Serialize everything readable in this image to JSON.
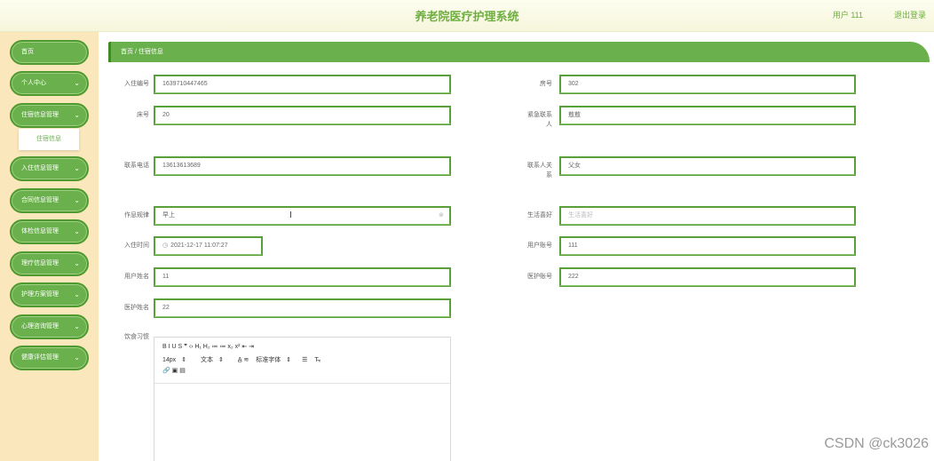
{
  "header": {
    "title": "养老院医疗护理系统",
    "user": "用户 111",
    "logout": "退出登录"
  },
  "sidebar": {
    "items": [
      {
        "label": "首页",
        "chevron": ""
      },
      {
        "label": "个人中心",
        "chevron": "⌄"
      },
      {
        "label": "住宿信息管理",
        "chevron": "⌄"
      },
      {
        "label": "入住信息管理",
        "chevron": "⌄"
      },
      {
        "label": "合同信息管理",
        "chevron": "⌄"
      },
      {
        "label": "体检信息管理",
        "chevron": "⌄"
      },
      {
        "label": "理疗信息管理",
        "chevron": "⌄"
      },
      {
        "label": "护理方案管理",
        "chevron": "⌄"
      },
      {
        "label": "心理咨询管理",
        "chevron": "⌄"
      },
      {
        "label": "健康评估管理",
        "chevron": "⌄"
      }
    ],
    "sub_item": "住宿信息"
  },
  "breadcrumb": "首页 / 住宿信息",
  "form": {
    "checkin_no": {
      "label": "入住编号",
      "value": "1639710447465"
    },
    "room_no": {
      "label": "房号",
      "value": "302"
    },
    "bed_no": {
      "label": "床号",
      "value": "20"
    },
    "emergency_contact": {
      "label_line1": "紧急联系",
      "label_line2": "人",
      "value": "敖敖"
    },
    "phone": {
      "label": "联系电话",
      "value": "13613613689"
    },
    "relation": {
      "label_line1": "联系人关",
      "label_line2": "系",
      "value": "父女"
    },
    "routine": {
      "label": "作息规律",
      "value": "早上"
    },
    "preference": {
      "label": "生活喜好",
      "placeholder": "生活喜好"
    },
    "checkin_time": {
      "label": "入住时间",
      "value": "2021-12-17 11:07:27"
    },
    "user_account": {
      "label": "用户账号",
      "value": "111"
    },
    "user_name": {
      "label": "用户姓名",
      "value": "11"
    },
    "nurse_account": {
      "label": "医护账号",
      "value": "222"
    },
    "nurse_name": {
      "label": "医护姓名",
      "value": "22"
    },
    "diet": {
      "label": "饮食习惯"
    }
  },
  "editor_toolbar": {
    "row1": "B  I  U  S   ❞  ‹›   H₁  H₂   ≔  ≔   x₂  x²   ⇤  ⇥",
    "font_size": "14px",
    "text_type": "文本",
    "align": "A̲  ≋",
    "font_family": "标准字体",
    "row3": "🔗 ▣ ▤"
  },
  "watermark": "CSDN @ck3026"
}
